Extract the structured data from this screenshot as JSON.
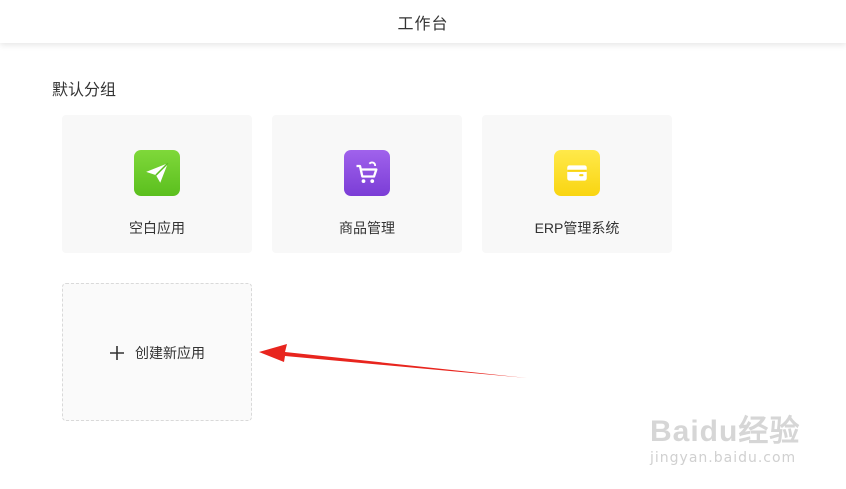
{
  "header": {
    "title": "工作台"
  },
  "group": {
    "title": "默认分组"
  },
  "apps": [
    {
      "label": "空白应用",
      "icon": "paper-plane-icon",
      "color": "#6cc929"
    },
    {
      "label": "商品管理",
      "icon": "shopping-cart-icon",
      "color": "#8e4ee0"
    },
    {
      "label": "ERP管理系统",
      "icon": "wallet-icon",
      "color": "#fde02a"
    }
  ],
  "create": {
    "label": "创建新应用",
    "icon": "plus-icon"
  },
  "annotation": {
    "arrow_color": "#e8251e"
  },
  "watermark": {
    "brand": "Baidu经验",
    "url": "jingyan.baidu.com"
  }
}
